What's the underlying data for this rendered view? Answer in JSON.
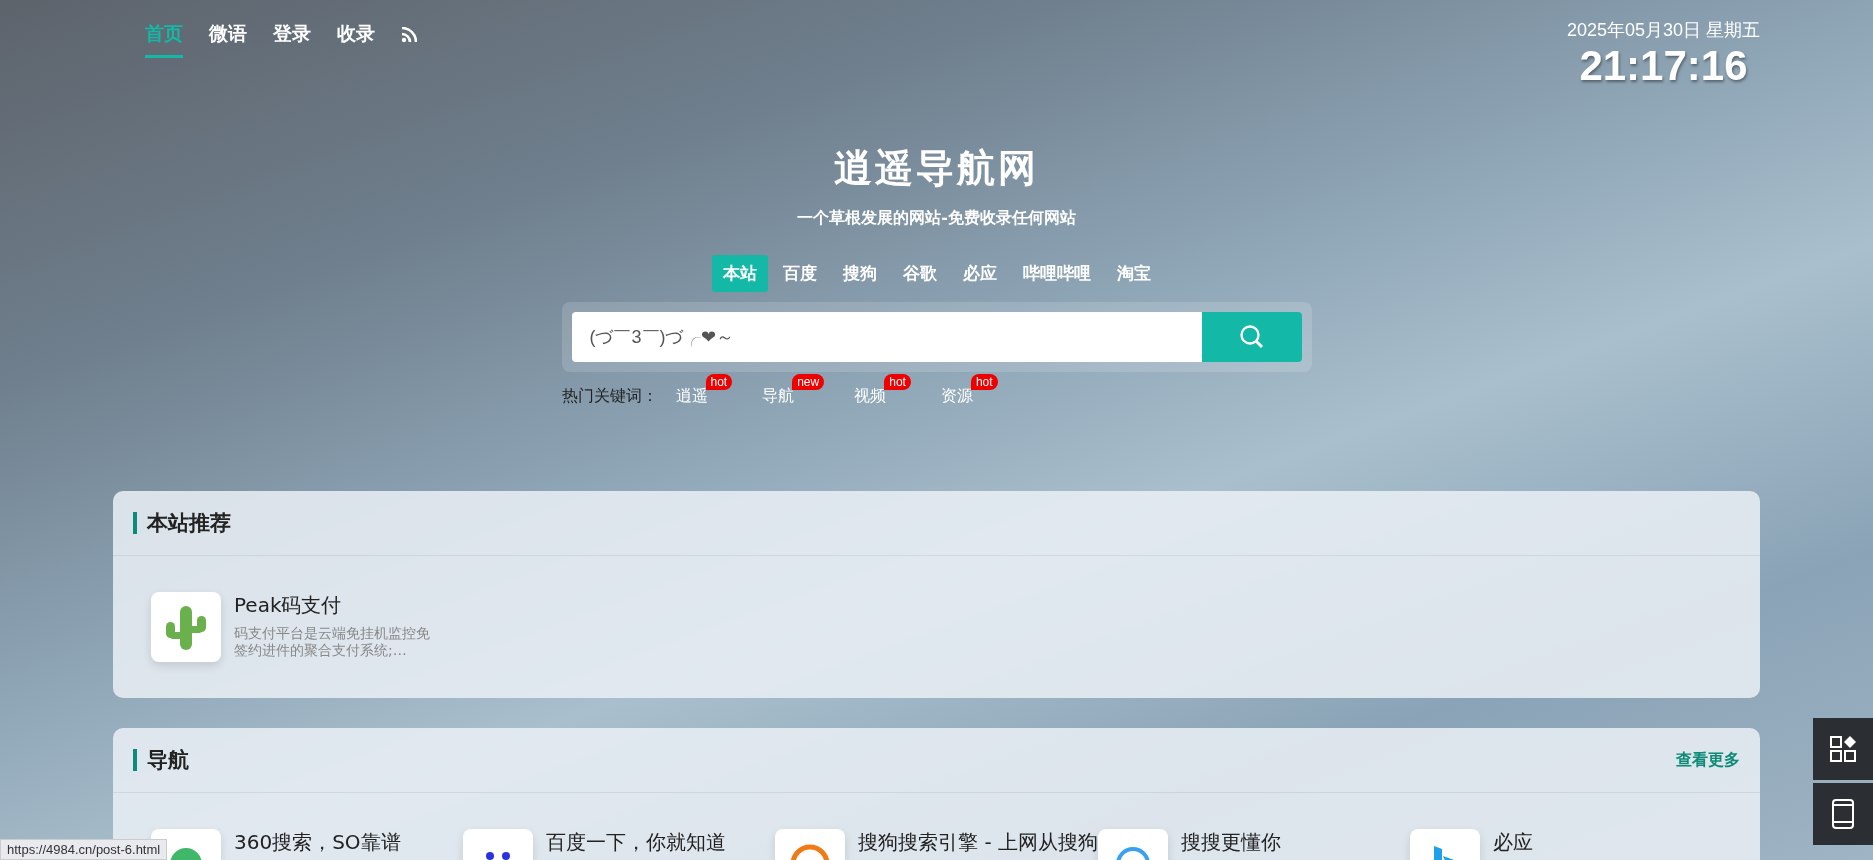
{
  "nav": [
    {
      "label": "首页",
      "selected": true
    },
    {
      "label": "微语",
      "selected": false
    },
    {
      "label": "登录",
      "selected": false
    },
    {
      "label": "收录",
      "selected": false
    }
  ],
  "clock": {
    "date": "2025年05月30日 星期五",
    "time": "21:17:16"
  },
  "hero": {
    "title": "逍遥导航网",
    "subtitle": "一个草根发展的网站-免费收录任何网站"
  },
  "search_tabs": [
    {
      "label": "本站",
      "selected": true
    },
    {
      "label": "百度",
      "selected": false
    },
    {
      "label": "搜狗",
      "selected": false
    },
    {
      "label": "谷歌",
      "selected": false
    },
    {
      "label": "必应",
      "selected": false
    },
    {
      "label": "哔哩哔哩",
      "selected": false
    },
    {
      "label": "淘宝",
      "selected": false
    }
  ],
  "search": {
    "placeholder": "(づ￣3￣)づ╭❤～"
  },
  "hot_keywords": {
    "label": "热门关键词：",
    "items": [
      {
        "label": "逍遥",
        "badge": "hot"
      },
      {
        "label": "导航",
        "badge": "new"
      },
      {
        "label": "视频",
        "badge": "hot"
      },
      {
        "label": "资源",
        "badge": "hot"
      }
    ]
  },
  "sections": [
    {
      "title": "本站推荐",
      "sites": [
        {
          "name": "Peak码支付",
          "desc": "码支付平台是云端免挂机监控免签约进件的聚合支付系统;…",
          "kind": "cactus"
        }
      ]
    },
    {
      "title": "导航",
      "more": "查看更多",
      "sites": [
        {
          "name": "360搜索，SO靠谱",
          "kind": "green"
        },
        {
          "name": "百度一下，你就知道",
          "kind": "paw"
        },
        {
          "name": "搜狗搜索引擎 - 上网从搜狗",
          "kind": "orange"
        },
        {
          "name": "搜搜更懂你",
          "kind": "ring"
        },
        {
          "name": "必应",
          "kind": "bing"
        }
      ]
    }
  ],
  "status_url": "https://4984.cn/post-6.html"
}
